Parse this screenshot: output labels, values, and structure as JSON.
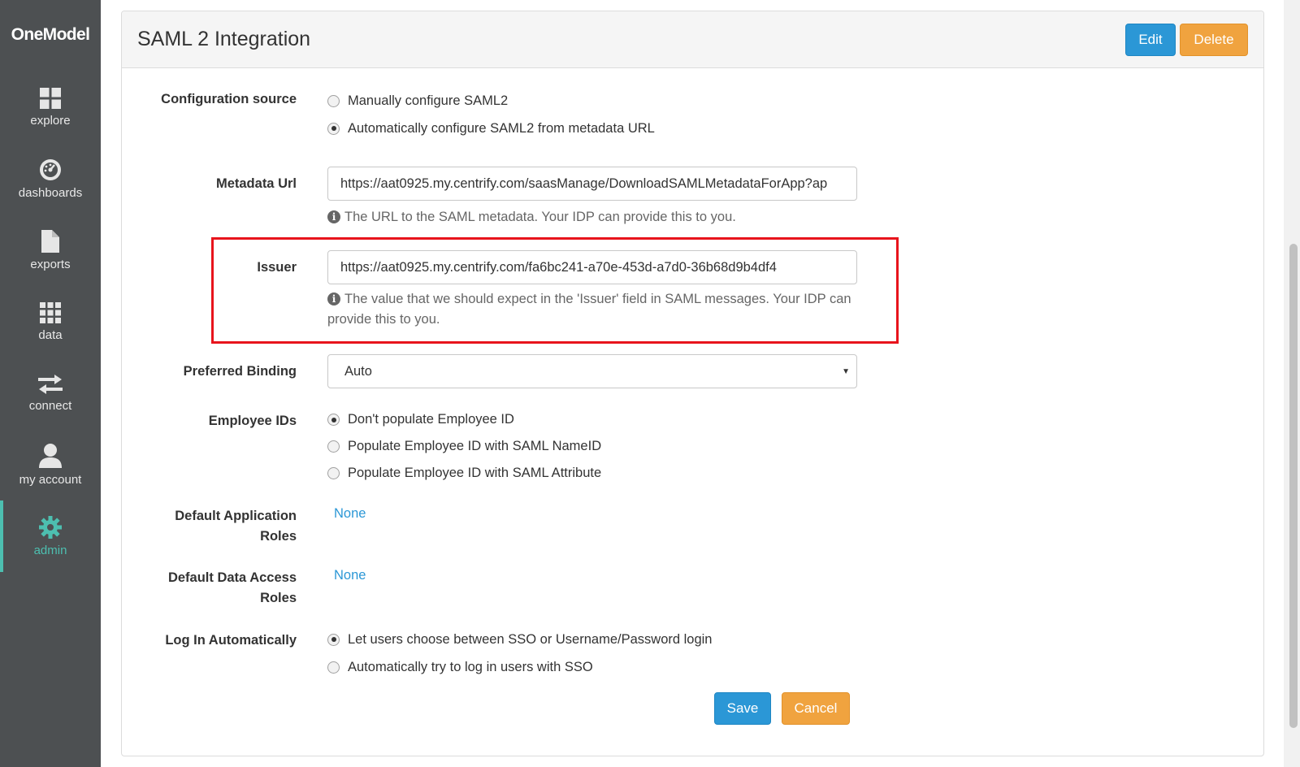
{
  "app": {
    "logo": "OneModel"
  },
  "sidebar": {
    "items": [
      {
        "label": "explore",
        "icon": "grid-icon"
      },
      {
        "label": "dashboards",
        "icon": "gauge-icon"
      },
      {
        "label": "exports",
        "icon": "document-icon"
      },
      {
        "label": "data",
        "icon": "table-icon"
      },
      {
        "label": "connect",
        "icon": "exchange-icon"
      },
      {
        "label": "my account",
        "icon": "user-icon"
      },
      {
        "label": "admin",
        "icon": "gear-icon",
        "active": true
      }
    ]
  },
  "panel": {
    "title": "SAML 2 Integration",
    "edit_label": "Edit",
    "delete_label": "Delete"
  },
  "form": {
    "config_source": {
      "label": "Configuration source",
      "options": [
        "Manually configure SAML2",
        "Automatically configure SAML2 from metadata URL"
      ],
      "selected": 1
    },
    "metadata_url": {
      "label": "Metadata Url",
      "value": "https://aat0925.my.centrify.com/saasManage/DownloadSAMLMetadataForApp?ap",
      "help": "The URL to the SAML metadata. Your IDP can provide this to you."
    },
    "issuer": {
      "label": "Issuer",
      "value": "https://aat0925.my.centrify.com/fa6bc241-a70e-453d-a7d0-36b68d9b4df4",
      "help": "The value that we should expect in the 'Issuer' field in SAML messages. Your IDP can provide this to you."
    },
    "preferred_binding": {
      "label": "Preferred Binding",
      "value": "Auto"
    },
    "employee_ids": {
      "label": "Employee IDs",
      "options": [
        "Don't populate Employee ID",
        "Populate Employee ID with SAML NameID",
        "Populate Employee ID with SAML Attribute"
      ],
      "selected": 0
    },
    "default_app_roles": {
      "label_line1": "Default Application",
      "label_line2": "Roles",
      "value": "None"
    },
    "default_data_roles": {
      "label_line1": "Default Data Access",
      "label_line2": "Roles",
      "value": "None"
    },
    "log_in_auto": {
      "label": "Log In Automatically",
      "options": [
        "Let users choose between SSO or Username/Password login",
        "Automatically try to log in users with SSO"
      ],
      "selected": 0
    },
    "save_label": "Save",
    "cancel_label": "Cancel"
  },
  "colors": {
    "accent": "#2b97d6",
    "warning": "#f0a33f",
    "admin_active": "#4dbfb0",
    "highlight": "#e8141c"
  }
}
